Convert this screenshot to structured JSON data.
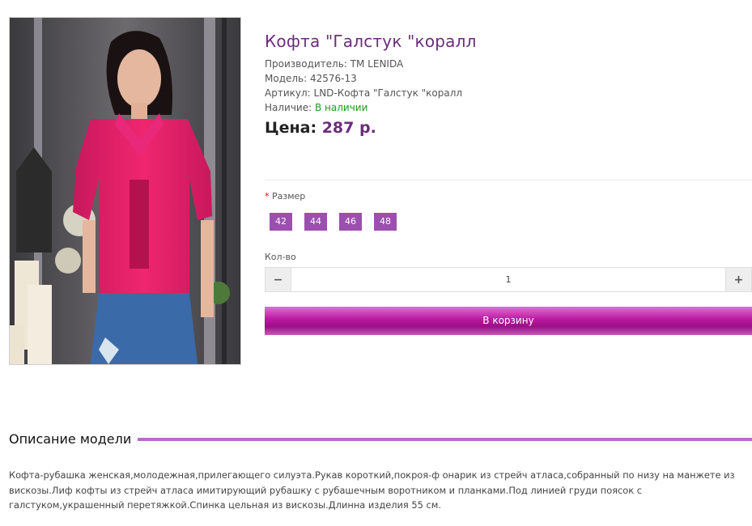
{
  "product": {
    "image_alt": "Кофта \"Галстук \"коралл",
    "title": "Кофта \"Галстук \"коралл",
    "manufacturer_label": "Производитель:",
    "manufacturer_value": "TM LENIDA",
    "model_label": "Модель:",
    "model_value": "42576-13",
    "sku_label": "Артикул:",
    "sku_value": "LND-Кофта \"Галстук \"коралл",
    "availability_label": "Наличие:",
    "availability_value": "В наличии",
    "price_label": "Цена:",
    "price_value": "287 р."
  },
  "options": {
    "required_mark": "*",
    "size_label": "Размер",
    "sizes": [
      "42",
      "44",
      "46",
      "48"
    ],
    "quantity_label": "Кол-во",
    "quantity_value": "1",
    "minus_symbol": "−",
    "plus_symbol": "+"
  },
  "cart": {
    "button_label": "В корзину"
  },
  "description": {
    "heading": "Описание модели",
    "text": "Кофта-рубашка женская,молодежная,прилегающего силуэта.Рукав короткий,покроя-ф онарик из стрейч атласа,собранный по низу на манжете из вискозы.Лиф кофты из стрейч атласа имитирующий рубашку с рубашечным воротником и планками.Под линией груди поясок с галстуком,украшенный перетяжкой.Спинка цельная из вискозы.Длинна изделия 55 см."
  },
  "colors": {
    "title": "#6b2d7b",
    "size_chip": "#9b4fae",
    "in_stock": "#1f9a1f",
    "cart_button": "#b8199e",
    "section_rule": "#b66dc6"
  }
}
